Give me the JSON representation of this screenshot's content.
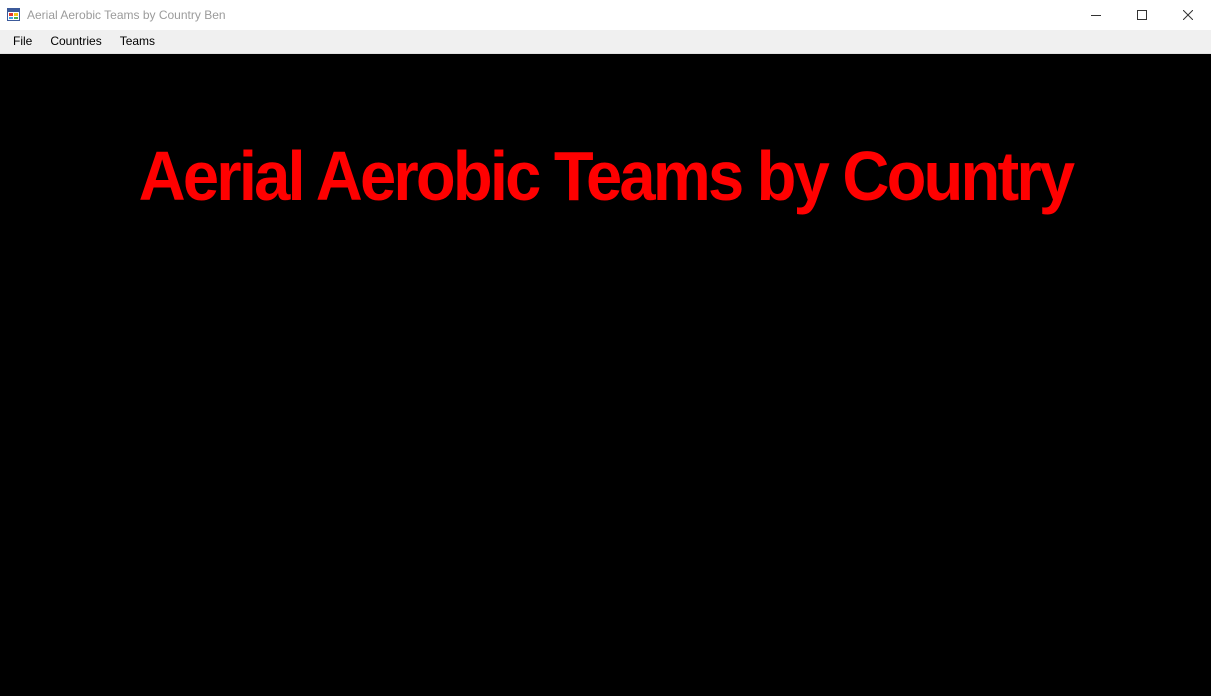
{
  "window": {
    "title": "Aerial Aerobic Teams by Country Ben",
    "icon": "app-window-icon",
    "controls": {
      "minimize_icon": "minimize-icon",
      "maximize_icon": "maximize-icon",
      "close_icon": "close-icon"
    }
  },
  "menu": {
    "items": [
      {
        "label": "File"
      },
      {
        "label": "Countries"
      },
      {
        "label": "Teams"
      }
    ]
  },
  "main": {
    "headline": "Aerial Aerobic Teams by Country",
    "headline_color": "#ff0000",
    "background_color": "#000000"
  }
}
